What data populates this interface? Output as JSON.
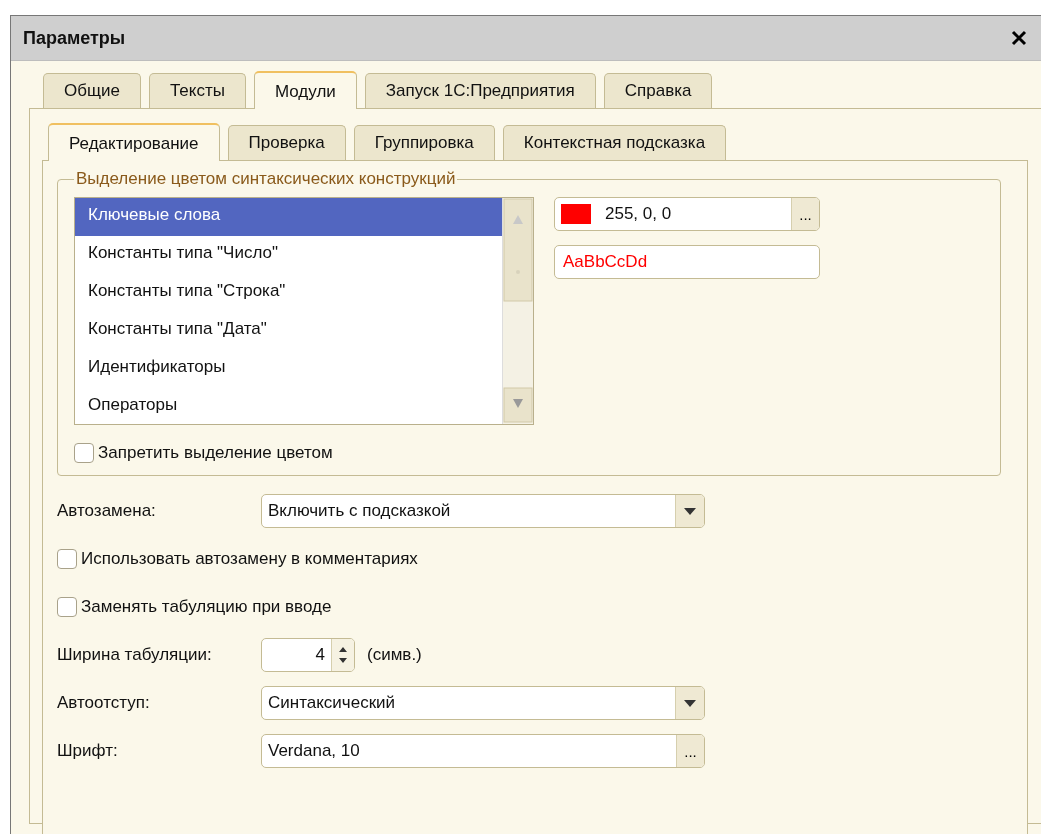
{
  "window": {
    "title": "Параметры"
  },
  "tabs": [
    {
      "label": "Общие",
      "selected": false
    },
    {
      "label": "Тексты",
      "selected": false
    },
    {
      "label": "Модули",
      "selected": true
    },
    {
      "label": "Запуск 1С:Предприятия",
      "selected": false
    },
    {
      "label": "Справка",
      "selected": false
    }
  ],
  "subtabs": [
    {
      "label": "Редактирование",
      "selected": true
    },
    {
      "label": "Проверка",
      "selected": false
    },
    {
      "label": "Группировка",
      "selected": false
    },
    {
      "label": "Контекстная подсказка",
      "selected": false
    }
  ],
  "syntax_group": {
    "title": "Выделение цветом синтаксических конструкций",
    "items": [
      {
        "label": "Ключевые слова",
        "selected": true
      },
      {
        "label": "Константы типа \"Число\"",
        "selected": false
      },
      {
        "label": "Константы типа \"Строка\"",
        "selected": false
      },
      {
        "label": "Константы типа \"Дата\"",
        "selected": false
      },
      {
        "label": "Идентификаторы",
        "selected": false
      },
      {
        "label": "Операторы",
        "selected": false
      }
    ],
    "color_field": {
      "color": "#ff0000",
      "value": "255, 0, 0",
      "button": "..."
    },
    "sample": {
      "text": "AaBbCcDd",
      "color": "#ff0000"
    },
    "disable_checkbox": {
      "label": "Запретить выделение цветом",
      "checked": false
    }
  },
  "settings": [
    {
      "kind": "select",
      "label": "Автозамена:",
      "value": "Включить с подсказкой"
    },
    {
      "kind": "checkbox",
      "label": "Использовать автозамену в комментариях",
      "checked": false
    },
    {
      "kind": "checkbox",
      "label": "Заменять табуляцию при вводе",
      "checked": false
    },
    {
      "kind": "spin",
      "label": "Ширина табуляции:",
      "value": "4",
      "unit": "(симв.)"
    },
    {
      "kind": "select",
      "label": "Автоотступ:",
      "value": "Синтаксический"
    },
    {
      "kind": "picker",
      "label": "Шрифт:",
      "value": "Verdana, 10",
      "button": "..."
    }
  ]
}
